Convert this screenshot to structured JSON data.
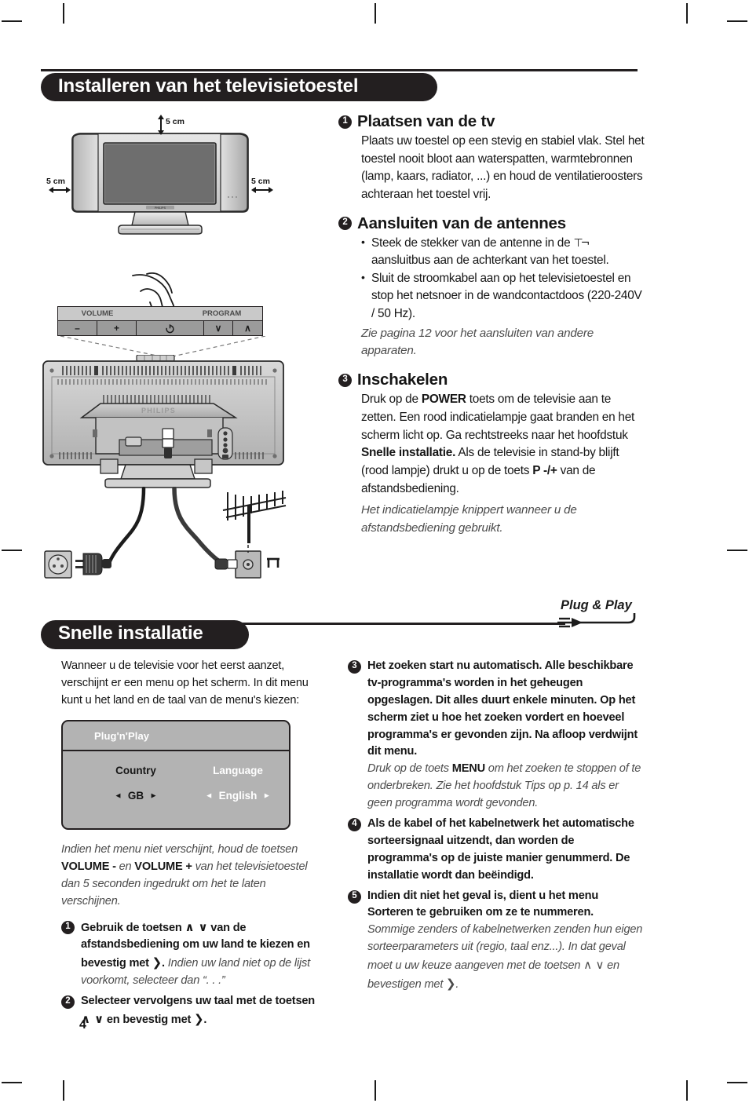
{
  "page": {
    "number": "4",
    "lang": "nl"
  },
  "sections": {
    "install": {
      "banner": "Installeren van het televisietoestel",
      "steps": [
        {
          "num": "❶",
          "title": "Plaatsen van de tv",
          "body": "Plaats uw toestel op een stevig en stabiel vlak. Stel het toestel nooit bloot aan waterspatten, warmtebronnen (lamp, kaars, radiator, ...) en houd de ventilatieroosters achteraan het toestel vrij."
        },
        {
          "num": "❷",
          "title": "Aansluiten van de antennes",
          "bullets": [
            "Steek de stekker van de antenne in de",
            "Sluit de stroomkabel aan op het televisietoestel en stop het netsnoer in de wandcontactdoos (220-240V / 50 Hz)."
          ],
          "bullet1_tail": "aansluitbus aan de achterkant van het toestel.",
          "note": "Zie pagina 12 voor het aansluiten van andere apparaten."
        },
        {
          "num": "❸",
          "title": "Inschakelen",
          "body_a": "Druk op de ",
          "body_b": "POWER",
          "body_c": " toets om de televisie aan te zetten. Een rood indicatielampje gaat branden en het scherm licht op. Ga rechtstreeks naar het hoofdstuk ",
          "body_d": "Snelle installatie.",
          "body_e": " Als de televisie in stand-by blijft (rood lampje) drukt u op de toets ",
          "body_f": "P -/+",
          "body_g": " van de afstandsbediening.",
          "note": "Het indicatielampje knippert wanneer u de afstandsbediening gebruikt."
        }
      ]
    },
    "quick": {
      "banner": "Snelle installatie",
      "logo": "Plug & Play",
      "intro": "Wanneer u de televisie voor het eerst aanzet, verschijnt er een menu op het scherm. In dit menu kunt u het land en de taal van de menu's kiezen:",
      "note_before_items": {
        "a": "Indien het menu niet verschijnt, houd de toetsen ",
        "b": "VOLUME - ",
        "c": "en ",
        "d": "VOLUME + ",
        "e": "van het televisietoestel dan 5 seconden ingedrukt om het te laten verschijnen."
      },
      "items": [
        {
          "num": "❶",
          "a": "Gebruik de toetsen ",
          "keys": "∧ ∨",
          "b": " van de afstandsbediening om uw land te kiezen en bevestig met ",
          "confirm": "❯",
          "c": ". ",
          "ital": "Indien uw land niet op de lijst voorkomt, selecteer dan “. . .”"
        },
        {
          "num": "❷",
          "a": "Selecteer vervolgens uw taal met de toetsen ",
          "keys": "∧ ∨",
          "b": " en bevestig met ",
          "confirm": "❯",
          "c": ".",
          "ital": ""
        },
        {
          "num": "❸",
          "a": "Het zoeken start nu automatisch. Alle beschikbare tv-programma's worden in het geheugen opgeslagen. Dit alles duurt enkele minuten. Op het scherm ziet u hoe het zoeken vordert en hoeveel programma's er gevonden zijn. Na afloop verdwijnt dit menu.",
          "ital_a": "Druk op de toets ",
          "ital_bold": "MENU",
          "ital_b": " om het zoeken te stoppen of te onderbreken. Zie het hoofdstuk Tips op p. 14 als er geen programma wordt gevonden."
        },
        {
          "num": "❹",
          "a": "Als de kabel of het kabelnetwerk het automatische sorteersignaal uitzendt, dan worden de programma's op de juiste manier genummerd. De installatie wordt dan beëindigd."
        },
        {
          "num": "❺",
          "a": "Indien dit niet het geval is, dient u het menu ",
          "bold": "Sorteren",
          "b": " te gebruiken om ze te nummeren.",
          "ital_a": "Sommige zenders of kabelnetwerken zenden hun eigen sorteerparameters uit (regio, taal enz...). In dat geval moet u uw keuze aangeven met de toetsen ",
          "ital_keys": "∧ ∨",
          "ital_b": " en bevestigen met ",
          "ital_confirm": "❯",
          "ital_c": "."
        }
      ]
    }
  },
  "osd_menu": {
    "title": "Plug'n'Play",
    "columns": [
      {
        "label": "Country",
        "left_arrow": "◄",
        "value": "GB",
        "right_arrow": "►"
      },
      {
        "label": "Language",
        "left_arrow": "◄",
        "value": "English",
        "right_arrow": "►"
      }
    ]
  },
  "illustration": {
    "clearance": {
      "top": "5 cm",
      "left": "5 cm",
      "right": "5 cm"
    },
    "control_panel": {
      "volume_label": "VOLUME",
      "program_label": "PROGRAM",
      "buttons": [
        {
          "name": "volume-down",
          "glyph": "–"
        },
        {
          "name": "volume-up",
          "glyph": "+"
        },
        {
          "name": "power",
          "glyph": "⏻"
        },
        {
          "name": "program-down",
          "glyph": "∨"
        },
        {
          "name": "program-up",
          "glyph": "∧"
        }
      ]
    },
    "brand": "PHILIPS"
  },
  "colors": {
    "ink": "#231f20",
    "italic_grey": "#4c4c4c",
    "osd_bg": "#b3b3b3",
    "panel_grey": "#9b9b9b"
  }
}
